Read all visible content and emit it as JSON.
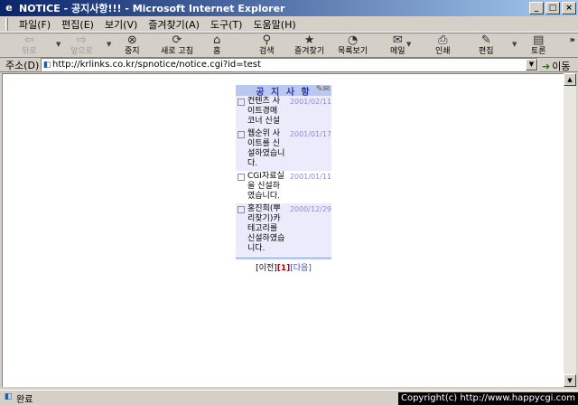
{
  "window": {
    "title": "NOTICE - 공지사항!!! - Microsoft Internet Explorer"
  },
  "menu": [
    "파일(F)",
    "편집(E)",
    "보기(V)",
    "즐겨찾기(A)",
    "도구(T)",
    "도움말(H)"
  ],
  "toolbar": {
    "back": "뒤로",
    "forward": "앞으로",
    "stop": "중지",
    "refresh": "새로 고침",
    "home": "홈",
    "search": "검색",
    "favorites": "즐겨찾기",
    "history": "목록보기",
    "mail": "메일",
    "print": "인쇄",
    "edit": "편집",
    "discuss": "토론",
    "more": "»"
  },
  "address": {
    "label": "주소(D)",
    "url": "http://krlinks.co.kr/spnotice/notice.cgi?id=test",
    "go": "이동"
  },
  "notice": {
    "title": "공 지 사 항",
    "items": [
      {
        "text": "컨텐츠 사이트경매 코너 신설",
        "date": "2001/02/11"
      },
      {
        "text": "웹순위 사이트를 신설하였습니다.",
        "date": "2001/01/17"
      },
      {
        "text": "CGI자료실을 신설하였습니다.",
        "date": "2001/01/11"
      },
      {
        "text": "홍진희(뿌리찾기)카테고리를 신설하였습니다.",
        "date": "2000/12/29"
      }
    ],
    "pager": {
      "prev": "[이전]",
      "current": "[1]",
      "next": "[다음]"
    }
  },
  "status": {
    "text": "완료",
    "copyright": "Copyright(c) http://www.happycgi.com"
  }
}
